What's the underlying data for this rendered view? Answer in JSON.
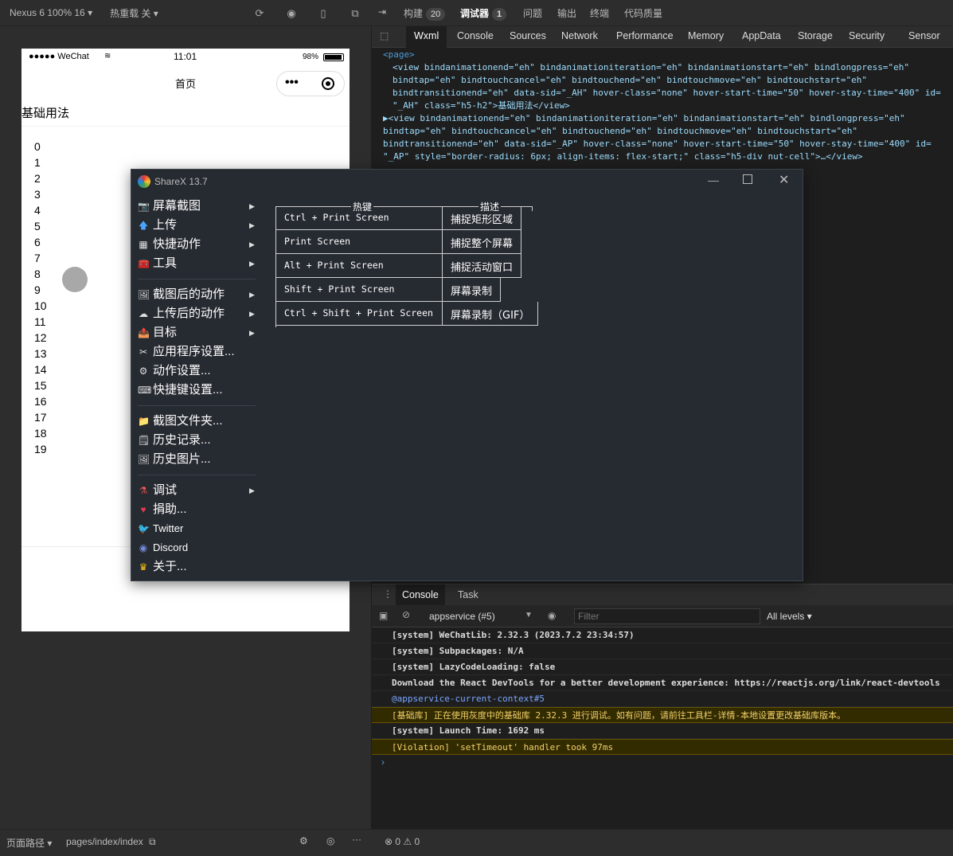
{
  "simulator": {
    "device": "Nexus 6 100% 16 ▾",
    "hot_reload": "热重载 关 ▾",
    "status": {
      "carrier": "●●●●● WeChat",
      "time": "11:01",
      "battery": "98%"
    },
    "nav_title": "首页",
    "section_title": "基础用法",
    "numbers": [
      "0",
      "1",
      "2",
      "3",
      "4",
      "5",
      "6",
      "7",
      "8",
      "9",
      "10",
      "11",
      "12",
      "13",
      "14",
      "15",
      "16",
      "17",
      "18",
      "19"
    ],
    "footer_path_label": "页面路径 ▾",
    "footer_path": "pages/index/index"
  },
  "devtools": {
    "top_tabs": [
      {
        "label": "构建",
        "badge": "20"
      },
      {
        "label": "调试器",
        "badge": "1"
      },
      {
        "label": "问题"
      },
      {
        "label": "输出"
      },
      {
        "label": "终端"
      },
      {
        "label": "代码质量"
      }
    ],
    "panel_tabs": [
      "Wxml",
      "Console",
      "Sources",
      "Network",
      "Performance",
      "Memory",
      "AppData",
      "Storage",
      "Security",
      "Sensor"
    ],
    "wxml_lines": [
      "<page>",
      "<view bindanimationend=\"eh\" bindanimationiteration=\"eh\" bindanimationstart=\"eh\" bindlongpress=\"eh\"",
      "bindtap=\"eh\" bindtouchcancel=\"eh\" bindtouchend=\"eh\" bindtouchmove=\"eh\" bindtouchstart=\"eh\"",
      "bindtransitionend=\"eh\" data-sid=\"_AH\" hover-class=\"none\" hover-start-time=\"50\" hover-stay-time=\"400\" id=",
      "\"_AH\" class=\"h5-h2\">基础用法</view>",
      "▶<view bindanimationend=\"eh\" bindanimationiteration=\"eh\" bindanimationstart=\"eh\" bindlongpress=\"eh\"",
      "bindtap=\"eh\" bindtouchcancel=\"eh\" bindtouchend=\"eh\" bindtouchmove=\"eh\" bindtouchstart=\"eh\"",
      "bindtransitionend=\"eh\" data-sid=\"_AP\" hover-class=\"none\" hover-start-time=\"50\" hover-stay-time=\"400\" id=",
      "\"_AP\" style=\"border-radius: 6px; align-items: flex-start;\" class=\"h5-div nut-cell\">…</view>"
    ],
    "console_tabs": [
      "Console",
      "Task"
    ],
    "context": "appservice (#5)",
    "filter_placeholder": "Filter",
    "levels": "All levels ▾",
    "console_lines": [
      {
        "text": "[system] WeChatLib: 2.32.3 (2023.7.2 23:34:57)",
        "kind": "normal"
      },
      {
        "text": "[system] Subpackages: N/A",
        "kind": "normal"
      },
      {
        "text": "[system] LazyCodeLoading: false",
        "kind": "normal"
      },
      {
        "text": "Download the React DevTools for a better development experience: https://reactjs.org/link/react-devtools",
        "kind": "normal"
      },
      {
        "text": "@appservice-current-context#5",
        "kind": "link"
      },
      {
        "text": "[基础库] 正在使用灰度中的基础库 2.32.3 进行调试。如有问题，请前往工具栏-详情-本地设置更改基础库版本。",
        "kind": "warn"
      },
      {
        "text": "[system] Launch Time: 1692 ms",
        "kind": "normal"
      },
      {
        "text": "[Violation] 'setTimeout' handler took 97ms",
        "kind": "warn"
      }
    ],
    "footer_status": "⊗ 0 ⚠ 0"
  },
  "sharex": {
    "title": "ShareX 13.7",
    "menu": [
      {
        "label": "屏幕截图",
        "icon": "camera-icon",
        "glyph": "📷",
        "arrow": true
      },
      {
        "label": "上传",
        "icon": "upload-arrow-icon",
        "glyph": "🡅",
        "arrow": true
      },
      {
        "label": "快捷动作",
        "icon": "grid-icon",
        "glyph": "▦",
        "arrow": true
      },
      {
        "label": "工具",
        "icon": "toolbox-icon",
        "glyph": "🧰",
        "arrow": true
      },
      {
        "sep": true
      },
      {
        "label": "截图后的动作",
        "icon": "image-action-icon",
        "glyph": "🖼",
        "arrow": true
      },
      {
        "label": "上传后的动作",
        "icon": "cloud-icon",
        "glyph": "☁",
        "arrow": true
      },
      {
        "label": "目标",
        "icon": "target-icon",
        "glyph": "📤",
        "arrow": true
      },
      {
        "label": "应用程序设置...",
        "icon": "wrench-icon",
        "glyph": "✂",
        "arrow": false
      },
      {
        "label": "动作设置...",
        "icon": "gear-icon",
        "glyph": "⚙",
        "arrow": false
      },
      {
        "label": "快捷键设置...",
        "icon": "keyboard-icon",
        "glyph": "⌨",
        "arrow": false
      },
      {
        "sep": true
      },
      {
        "label": "截图文件夹...",
        "icon": "folder-icon",
        "glyph": "📁",
        "arrow": false
      },
      {
        "label": "历史记录...",
        "icon": "history-icon",
        "glyph": "🗒",
        "arrow": false
      },
      {
        "label": "历史图片...",
        "icon": "gallery-icon",
        "glyph": "🖼",
        "arrow": false
      },
      {
        "sep": true
      },
      {
        "label": "调试",
        "icon": "flask-icon",
        "glyph": "⚗",
        "arrow": true
      },
      {
        "label": "捐助...",
        "icon": "heart-icon",
        "glyph": "♥",
        "arrow": false
      },
      {
        "label": "Twitter",
        "icon": "twitter-icon",
        "glyph": "🐦",
        "arrow": false
      },
      {
        "label": "Discord",
        "icon": "discord-icon",
        "glyph": "◉",
        "arrow": false
      },
      {
        "label": "关于...",
        "icon": "crown-icon",
        "glyph": "♛",
        "arrow": false
      }
    ],
    "hotkeys_header": {
      "key": "热键",
      "desc": "描述"
    },
    "hotkeys": [
      {
        "key": "Ctrl + Print Screen",
        "desc": "捕捉矩形区域"
      },
      {
        "key": "Print Screen",
        "desc": "捕捉整个屏幕"
      },
      {
        "key": "Alt + Print Screen",
        "desc": "捕捉活动窗口"
      },
      {
        "key": "Shift + Print Screen",
        "desc": "屏幕录制"
      },
      {
        "key": "Ctrl + Shift + Print Screen",
        "desc": "屏幕录制（GIF）"
      }
    ]
  }
}
